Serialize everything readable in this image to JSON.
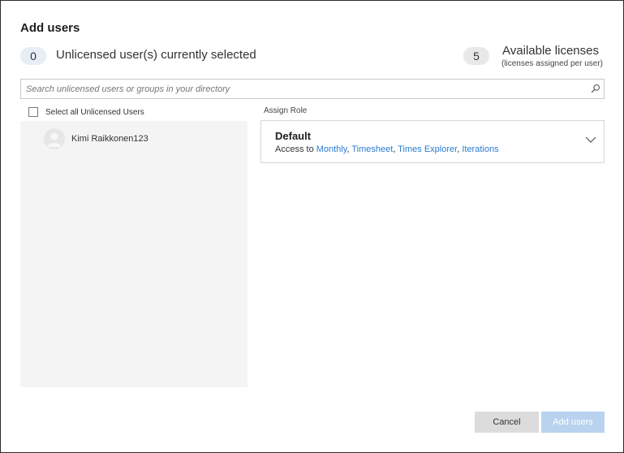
{
  "dialog": {
    "title": "Add users"
  },
  "selection": {
    "count": "0",
    "label": "Unlicensed user(s) currently selected"
  },
  "licenses": {
    "count": "5",
    "title": "Available licenses",
    "subtitle": "(licenses assigned per user)"
  },
  "search": {
    "placeholder": "Search unlicensed users or groups in your directory",
    "value": "",
    "icon": "search-icon"
  },
  "user_list": {
    "select_all_label": "Select all Unlicensed Users",
    "select_all_checked": false,
    "users": [
      {
        "name": "Kimi Raikkonen123",
        "avatar": "person-avatar-icon"
      }
    ]
  },
  "assign_role": {
    "label": "Assign Role",
    "selected_role": "Default",
    "access_prefix": "Access to ",
    "access_items": [
      "Monthly",
      "Timesheet",
      "Times Explorer",
      "Iterations"
    ],
    "separator": ", ",
    "dropdown_icon": "chevron-down-icon"
  },
  "footer": {
    "cancel_label": "Cancel",
    "add_label": "Add users"
  },
  "colors": {
    "link": "#2b7cd3",
    "primary_disabled": "#b9d3ef",
    "secondary_button": "#dcdcdc",
    "list_background": "#f4f4f4"
  }
}
